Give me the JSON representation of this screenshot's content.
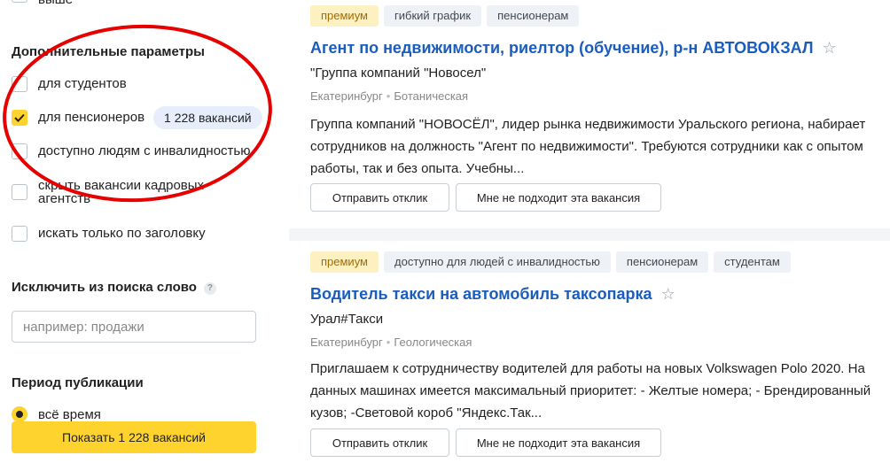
{
  "sidebar": {
    "cut_label": "выше",
    "extra_params_title": "Дополнительные параметры",
    "extra_params": [
      {
        "label": "для студентов",
        "checked": false
      },
      {
        "label": "для пенсионеров",
        "checked": true,
        "badge": "1 228 вакансий"
      },
      {
        "label": "доступно людям с инвалидностью",
        "checked": false
      },
      {
        "label": "скрыть вакансии кадровых агентств",
        "checked": false
      },
      {
        "label": "искать только по заголовку",
        "checked": false
      }
    ],
    "exclude_title": "Исключить из поиска слово",
    "exclude_help": "?",
    "exclude_placeholder": "например: продажи",
    "period_title": "Период публикации",
    "period_options": [
      {
        "label": "всё время",
        "selected": true
      }
    ],
    "show_button": "Показать 1 228 вакансий"
  },
  "vacancies": [
    {
      "tags": [
        "премиум",
        "гибкий график",
        "пенсионерам"
      ],
      "title": "Агент по недвижимости, риелтор (обучение), р-н АВТОВОКЗАЛ",
      "company": "\"Группа компаний \"Новосел\"",
      "city": "Екатеринбург",
      "metro": "Ботаническая",
      "description": "Группа компаний \"НОВОСЁЛ\", лидер рынка недвижимости Уральского региона, набирает сотрудников на должность \"Агент по недвижимости\". Требуются сотрудники как с опытом работы, так и без опыта. Учебны...",
      "apply_label": "Отправить отклик",
      "reject_label": "Мне не подходит эта вакансия"
    },
    {
      "tags": [
        "премиум",
        "доступно для людей с инвалидностью",
        "пенсионерам",
        "студентам"
      ],
      "title": "Водитель такси на автомобиль таксопарка",
      "company": "Урал#Такси",
      "city": "Екатеринбург",
      "metro": "Геологическая",
      "description": "Приглашаем к сотрудничеству водителей для работы на новых Volkswagen Polo 2020. На данных машинах имеется максимальный приоритет: - Желтые номера; - Брендированный кузов; -Световой короб \"Яндекс.Так...",
      "apply_label": "Отправить отклик",
      "reject_label": "Мне не подходит эта вакансия"
    }
  ],
  "colors": {
    "accent": "#ffd32d",
    "link": "#1a5dbd",
    "annotation": "#e60000"
  }
}
